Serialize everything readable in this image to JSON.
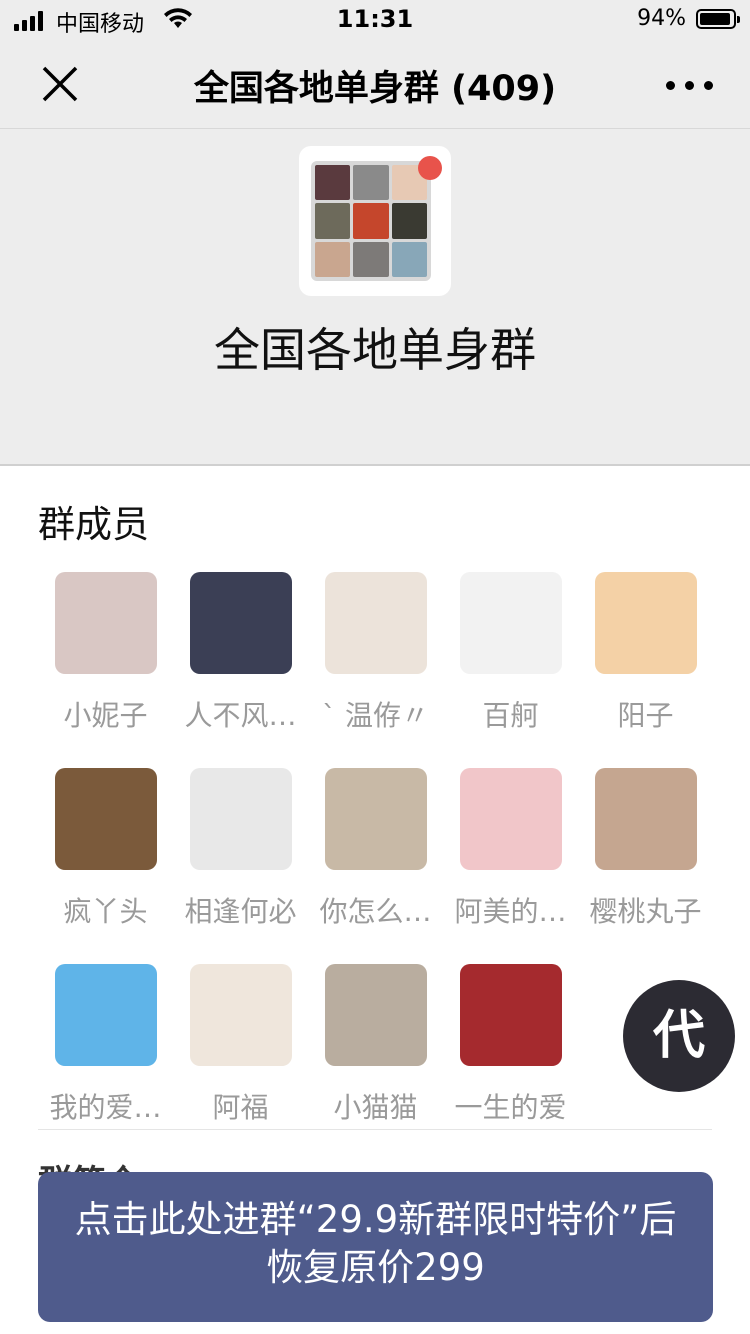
{
  "status_bar": {
    "carrier": "中国移动",
    "time": "11:31",
    "battery": "94%"
  },
  "nav": {
    "title": "全国各地单身群 (409)"
  },
  "group": {
    "name": "全国各地单身群"
  },
  "members_section": {
    "title": "群成员"
  },
  "members": [
    {
      "name": "小妮子",
      "color": "#d9c7c4"
    },
    {
      "name": "人不风…",
      "color": "#3b3f55"
    },
    {
      "name": "` 温侟〃",
      "color": "#ece3da"
    },
    {
      "name": "百舸",
      "color": "#f2f2f2"
    },
    {
      "name": "阳子",
      "color": "#f4d1a6"
    },
    {
      "name": "疯丫头",
      "color": "#7b5a3b"
    },
    {
      "name": "相逢何必",
      "color": "#e8e8e8"
    },
    {
      "name": "你怎么…",
      "color": "#c8b9a6"
    },
    {
      "name": "阿美的…",
      "color": "#f1c6c9"
    },
    {
      "name": "樱桃丸子",
      "color": "#c5a690"
    },
    {
      "name": "我的爱…",
      "color": "#5fb4e8"
    },
    {
      "name": "阿福",
      "color": "#efe6dc"
    },
    {
      "name": "小猫猫",
      "color": "#b9ad9f"
    },
    {
      "name": "一生的爱",
      "color": "#a52a2e"
    }
  ],
  "partial_section": {
    "title": "群简介"
  },
  "badge": {
    "label": "代"
  },
  "banner": {
    "line1": "点击此处进群“29.9新群限时特价”后",
    "line2": "恢复原价299"
  },
  "colors": {
    "nav_bg": "#ededed",
    "banner_bg": "#4f5b8c",
    "red_dot": "#e8534b",
    "badge_bg": "#2c2b33"
  }
}
